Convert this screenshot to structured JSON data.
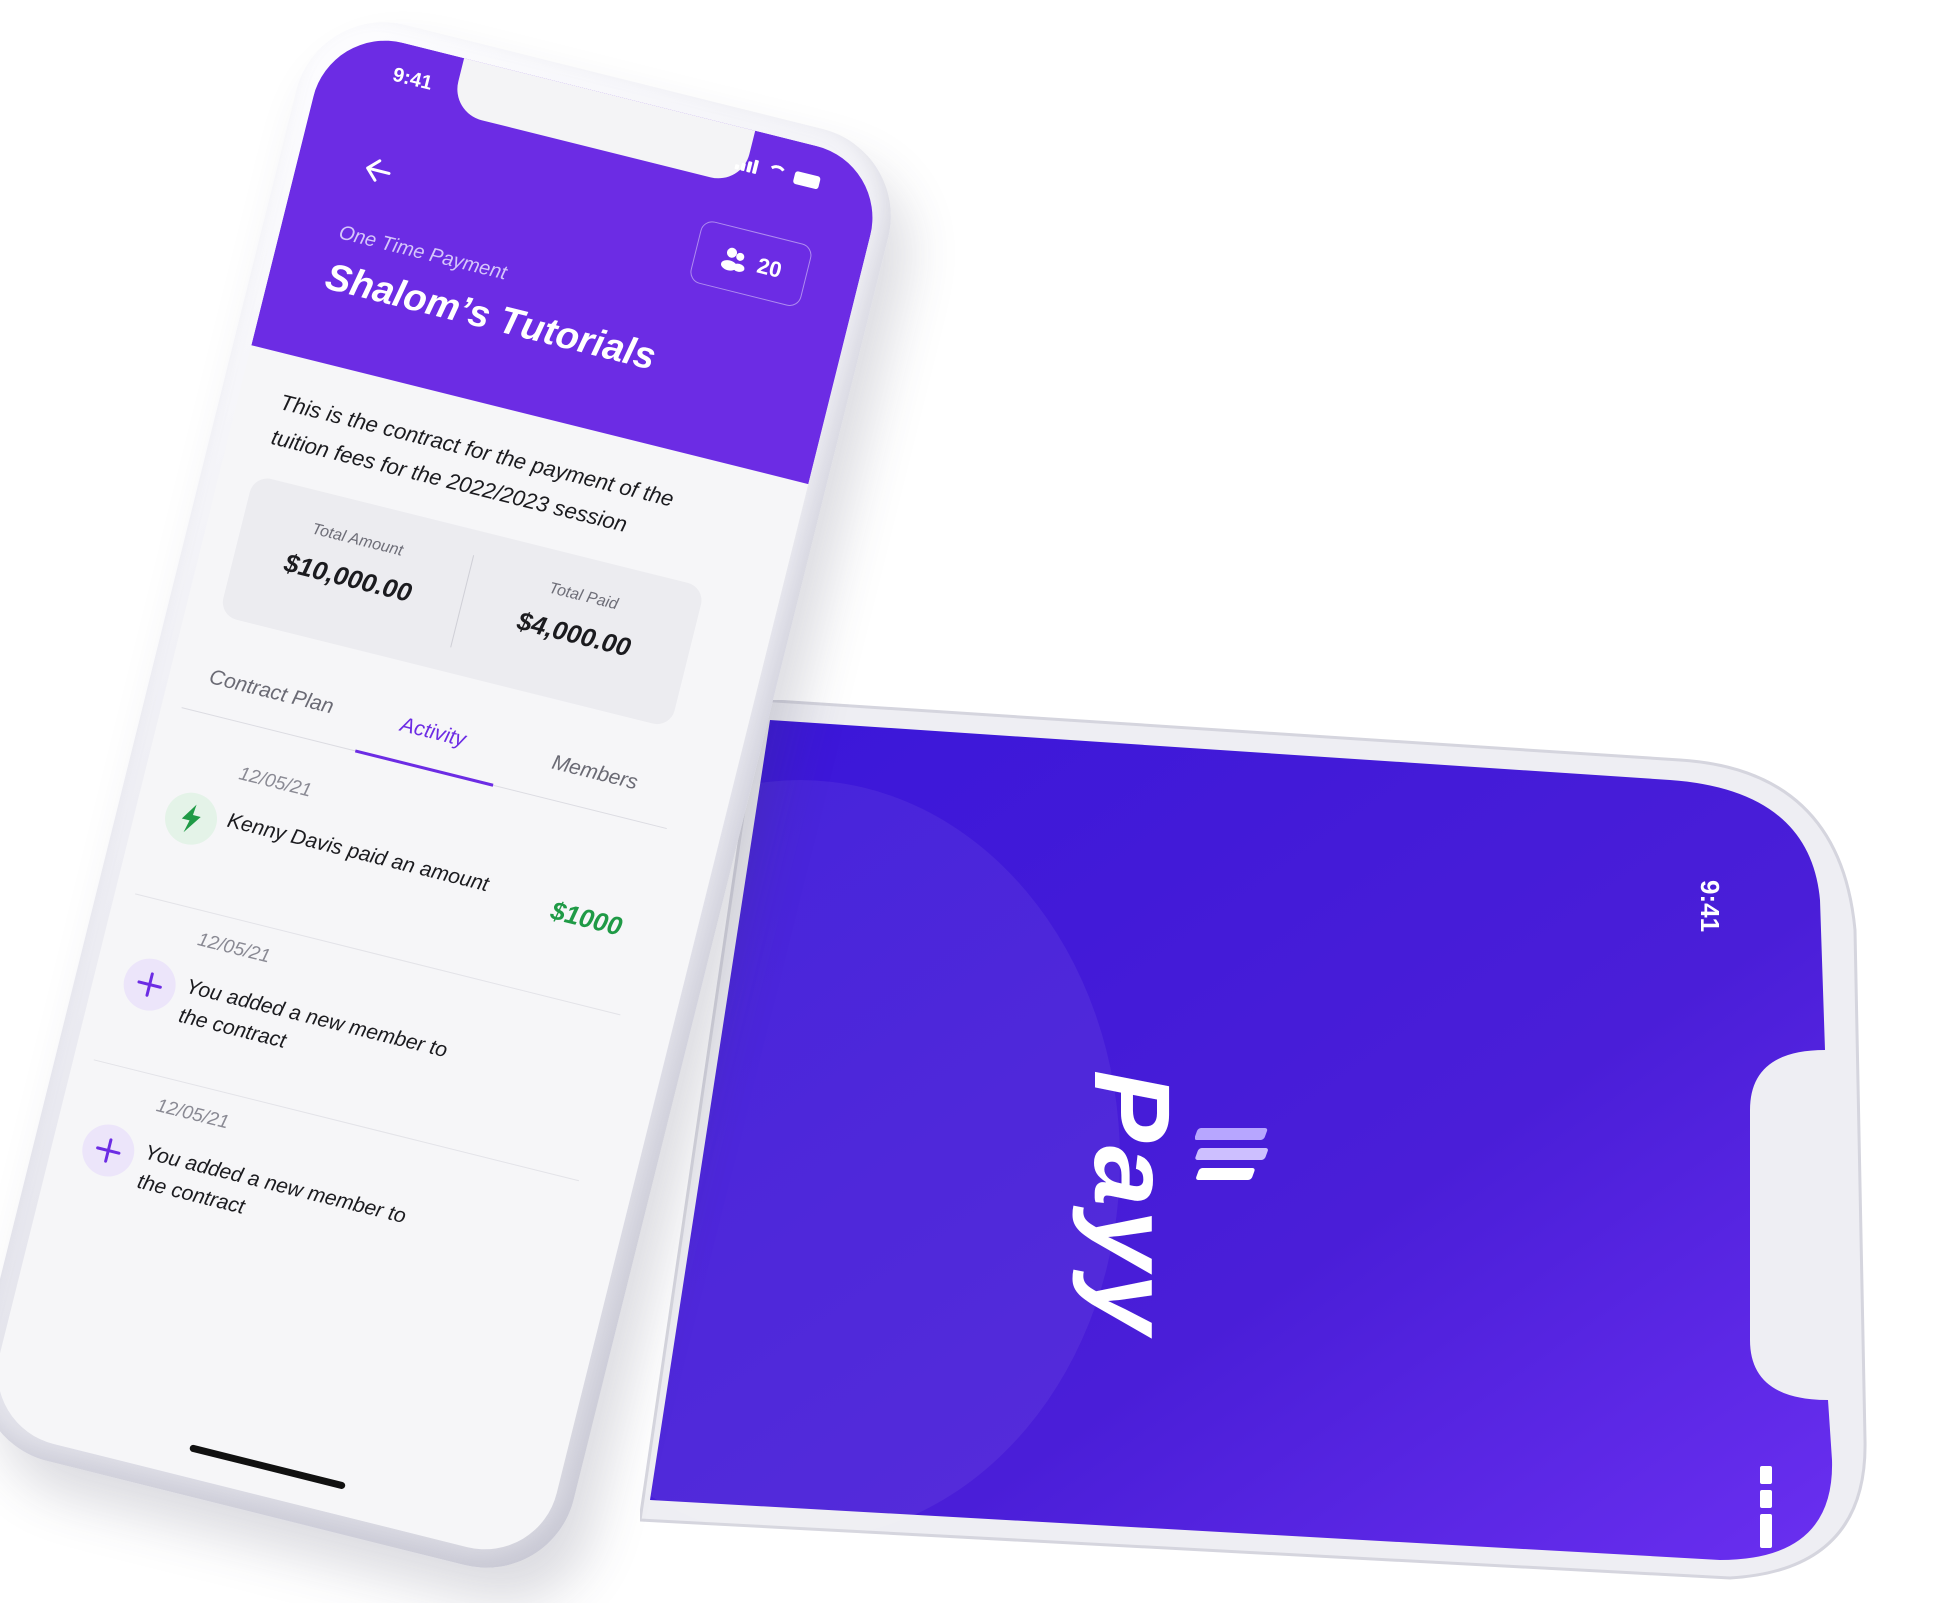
{
  "front_phone": {
    "status_bar": {
      "time": "9:41"
    },
    "header": {
      "back_icon": "arrow-left-icon",
      "members_icon": "users-icon",
      "members_count": "20",
      "payment_type": "One Time Payment",
      "title": "Shalom’s Tutorials",
      "background_color": "#6c2ce4"
    },
    "description": "This is the contract for the payment of the tuition fees for the 2022/2023 session",
    "summary": {
      "total_amount_label": "Total Amount",
      "total_amount_value": "$10,000.00",
      "total_paid_label": "Total Paid",
      "total_paid_value": "$4,000.00"
    },
    "tabs": [
      {
        "label": "Contract Plan",
        "active": false
      },
      {
        "label": "Activity",
        "active": true
      },
      {
        "label": "Members",
        "active": false
      }
    ],
    "activity": [
      {
        "date": "12/05/21",
        "icon": "lightning-icon",
        "text": "Kenny Davis paid an amount",
        "amount": "$1000"
      },
      {
        "date": "12/05/21",
        "icon": "plus-icon",
        "text": "You added a new member to the contract",
        "amount": ""
      },
      {
        "date": "12/05/21",
        "icon": "plus-icon",
        "text": "You added a new member to the contract",
        "amount": ""
      }
    ]
  },
  "back_phone": {
    "status_bar": {
      "time": "9:41"
    },
    "brand": "Payy",
    "background_color": "#4b1fd6"
  }
}
